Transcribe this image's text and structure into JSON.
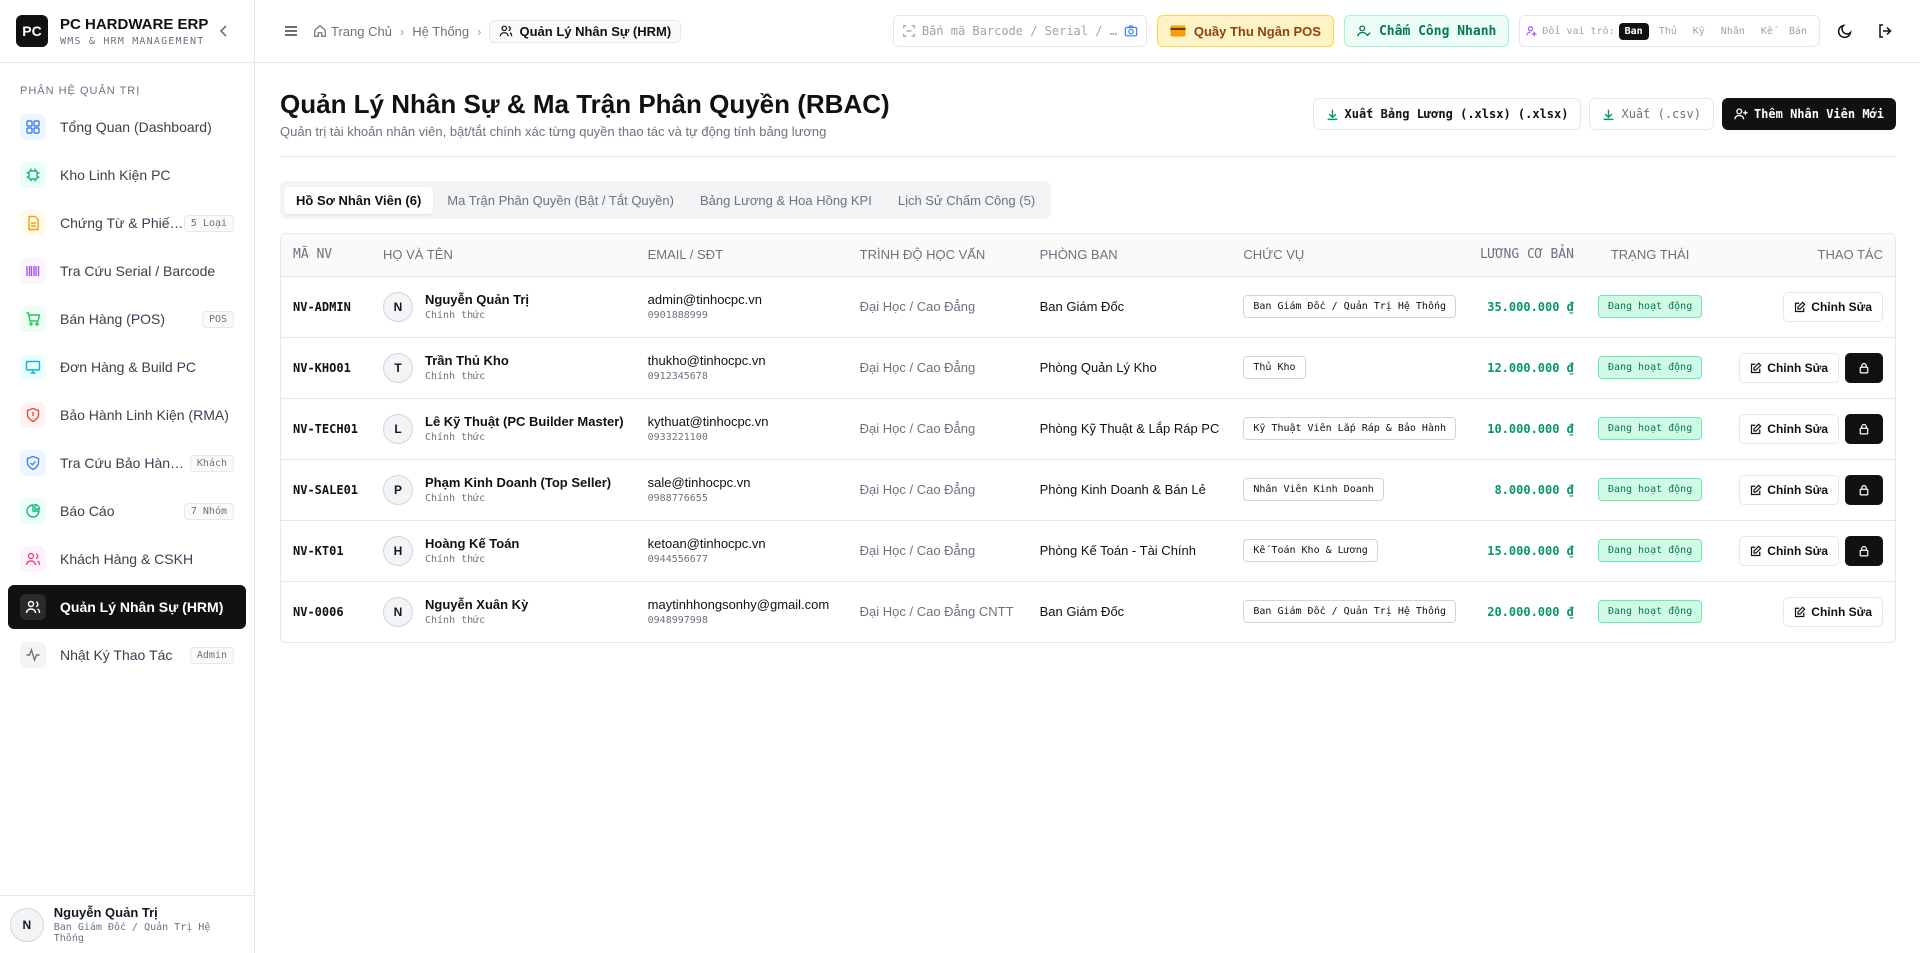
{
  "brand": {
    "logo": "PC",
    "title": "PC HARDWARE ERP",
    "subtitle": "WMS & HRM MANAGEMENT"
  },
  "sidebar": {
    "section_title": "PHÂN HỆ QUẢN TRỊ",
    "items": [
      {
        "label": "Tổng Quan (Dashboard)",
        "badge": "",
        "icon": "dashboard-icon",
        "color": "#3b82f6"
      },
      {
        "label": "Kho Linh Kiện PC",
        "badge": "",
        "icon": "chip-icon",
        "color": "#10b981"
      },
      {
        "label": "Chứng Từ & Phiếu...",
        "badge": "5 Loại",
        "icon": "document-icon",
        "color": "#f59e0b"
      },
      {
        "label": "Tra Cứu Serial / Barcode",
        "badge": "",
        "icon": "barcode-icon",
        "color": "#a855f7"
      },
      {
        "label": "Bán Hàng (POS)",
        "badge": "POS",
        "icon": "cart-icon",
        "color": "#22c55e"
      },
      {
        "label": "Đơn Hàng & Build PC",
        "badge": "",
        "icon": "monitor-icon",
        "color": "#06b6d4"
      },
      {
        "label": "Bảo Hành Linh Kiện (RMA)",
        "badge": "",
        "icon": "shield-alert-icon",
        "color": "#ef4444"
      },
      {
        "label": "Tra Cứu Bảo Hành ...",
        "badge": "Khách",
        "icon": "shield-check-icon",
        "color": "#3b82f6"
      },
      {
        "label": "Báo Cáo",
        "badge": "7 Nhóm",
        "icon": "pie-chart-icon",
        "color": "#10b981"
      },
      {
        "label": "Khách Hàng & CSKH",
        "badge": "",
        "icon": "users-icon",
        "color": "#ec4899"
      },
      {
        "label": "Quản Lý Nhân Sự (HRM)",
        "badge": "",
        "icon": "users-icon",
        "color": "#ffffff",
        "active": true
      },
      {
        "label": "Nhật Ký Thao Tác",
        "badge": "Admin",
        "icon": "activity-icon",
        "color": "#6b7280"
      }
    ],
    "user": {
      "initial": "N",
      "name": "Nguyễn Quản Trị",
      "role": "Ban Giám Đốc / Quản Trị Hệ Thống"
    }
  },
  "topbar": {
    "breadcrumb": {
      "home": "Trang Chủ",
      "system": "Hệ Thống",
      "current": "Quản Lý Nhân Sự (HRM)"
    },
    "search": {
      "placeholder": "Bắn mã Barcode / Serial / S..."
    },
    "pos_button": "Quầy Thu Ngân POS",
    "checkin_button": "Chấm Công Nhanh",
    "role_switch": {
      "label": "Đổi vai trò:",
      "options": [
        "Ban",
        "Thủ",
        "Kỹ",
        "Nhân",
        "Kế",
        "Bán"
      ],
      "selected": 0
    }
  },
  "page": {
    "title": "Quản Lý Nhân Sự & Ma Trận Phân Quyền (RBAC)",
    "subtitle": "Quản trị tài khoản nhân viên, bật/tắt chính xác từng quyền thao tác và tự động tính bảng lương",
    "export_xlsx": "Xuất Bảng Lương (.xlsx) (.xlsx)",
    "export_csv": "Xuất (.csv)",
    "add_employee": "Thêm Nhân Viên Mới"
  },
  "tabs": [
    {
      "label": "Hồ Sơ Nhân Viên (6)",
      "active": true
    },
    {
      "label": "Ma Trận Phân Quyền (Bật / Tắt Quyền)"
    },
    {
      "label": "Bảng Lương & Hoa Hồng KPI"
    },
    {
      "label": "Lịch Sử Chấm Công (5)"
    }
  ],
  "table": {
    "headers": {
      "code": "MÃ NV",
      "name": "HỌ VÀ TÊN",
      "contact": "EMAIL / SĐT",
      "education": "TRÌNH ĐỘ HỌC VẤN",
      "department": "PHÒNG BAN",
      "position": "CHỨC VỤ",
      "salary": "LƯƠNG CƠ BẢN",
      "status": "TRẠNG THÁI",
      "actions": "THAO TÁC"
    },
    "edit_label": "Chỉnh Sửa",
    "rows": [
      {
        "code": "NV-ADMIN",
        "initial": "N",
        "name": "Nguyễn Quản Trị",
        "type": "Chính thức",
        "email": "admin@tinhocpc.vn",
        "phone": "0901888999",
        "education": "Đại Học / Cao Đẳng",
        "department": "Ban Giám Đốc",
        "position": "Ban Giám Đốc / Quản Trị Hệ Thống",
        "salary": "35.000.000 ₫",
        "status": "Đang hoạt động",
        "lock": false
      },
      {
        "code": "NV-KHO01",
        "initial": "T",
        "name": "Trần Thủ Kho",
        "type": "Chính thức",
        "email": "thukho@tinhocpc.vn",
        "phone": "0912345678",
        "education": "Đại Học / Cao Đẳng",
        "department": "Phòng Quản Lý Kho",
        "position": "Thủ Kho",
        "salary": "12.000.000 ₫",
        "status": "Đang hoạt động",
        "lock": true
      },
      {
        "code": "NV-TECH01",
        "initial": "L",
        "name": "Lê Kỹ Thuật (PC Builder Master)",
        "type": "Chính thức",
        "email": "kythuat@tinhocpc.vn",
        "phone": "0933221100",
        "education": "Đại Học / Cao Đẳng",
        "department": "Phòng Kỹ Thuật & Lắp Ráp PC",
        "position": "Kỹ Thuật Viên Lắp Ráp & Bảo Hành",
        "salary": "10.000.000 ₫",
        "status": "Đang hoạt động",
        "lock": true
      },
      {
        "code": "NV-SALE01",
        "initial": "P",
        "name": "Phạm Kinh Doanh (Top Seller)",
        "type": "Chính thức",
        "email": "sale@tinhocpc.vn",
        "phone": "0988776655",
        "education": "Đại Học / Cao Đẳng",
        "department": "Phòng Kinh Doanh & Bán Lẻ",
        "position": "Nhân Viên Kinh Doanh",
        "salary": "8.000.000 ₫",
        "status": "Đang hoạt động",
        "lock": true
      },
      {
        "code": "NV-KT01",
        "initial": "H",
        "name": "Hoàng Kế Toán",
        "type": "Chính thức",
        "email": "ketoan@tinhocpc.vn",
        "phone": "0944556677",
        "education": "Đại Học / Cao Đẳng",
        "department": "Phòng Kế Toán - Tài Chính",
        "position": "Kế Toán Kho & Lương",
        "salary": "15.000.000 ₫",
        "status": "Đang hoạt động",
        "lock": true
      },
      {
        "code": "NV-0006",
        "initial": "N",
        "name": "Nguyễn Xuân Kỳ",
        "type": "Chính thức",
        "email": "maytinhhongsonhy@gmail.com",
        "phone": "0948997998",
        "education": "Đại Học / Cao Đẳng CNTT",
        "department": "Ban Giám Đốc",
        "position": "Ban Giám Đốc / Quản Trị Hệ Thống",
        "salary": "20.000.000 ₫",
        "status": "Đang hoạt động",
        "lock": false
      }
    ]
  }
}
